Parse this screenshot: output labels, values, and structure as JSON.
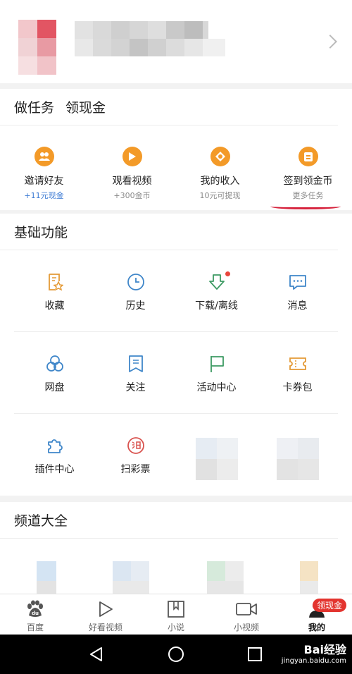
{
  "tasks": {
    "title": "做任务",
    "subtitle": "领现金",
    "items": [
      {
        "label": "邀请好友",
        "sub": "+11元现金",
        "icon": "people-icon"
      },
      {
        "label": "观看视频",
        "sub": "+300金币",
        "icon": "play-icon"
      },
      {
        "label": "我的收入",
        "sub": "10元可提现",
        "icon": "coin-icon"
      },
      {
        "label": "签到领金币",
        "sub": "更多任务",
        "icon": "checkin-icon"
      }
    ]
  },
  "basic": {
    "title": "基础功能",
    "items": [
      {
        "label": "收藏"
      },
      {
        "label": "历史"
      },
      {
        "label": "下载/离线"
      },
      {
        "label": "消息"
      },
      {
        "label": "网盘"
      },
      {
        "label": "关注"
      },
      {
        "label": "活动中心"
      },
      {
        "label": "卡券包"
      },
      {
        "label": "插件中心"
      },
      {
        "label": "扫彩票"
      }
    ]
  },
  "channels": {
    "title": "频道大全"
  },
  "tabbar": {
    "items": [
      {
        "label": "百度"
      },
      {
        "label": "好看视频"
      },
      {
        "label": "小说"
      },
      {
        "label": "小视频"
      },
      {
        "label": "我的"
      }
    ],
    "badge": "领现金"
  },
  "watermark": {
    "brand": "Bai经验",
    "url": "jingyan.baidu.com"
  }
}
